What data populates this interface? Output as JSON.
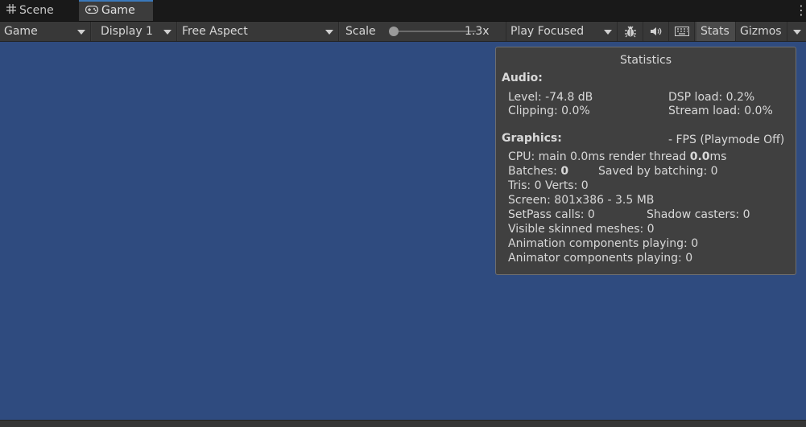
{
  "tabs": [
    {
      "label": "Scene",
      "icon": "grid-icon"
    },
    {
      "label": "Game",
      "icon": "gamepad-icon"
    }
  ],
  "toolbar": {
    "game_dropdown": "Game",
    "display_dropdown": "Display 1",
    "aspect_dropdown": "Free Aspect",
    "scale_label": "Scale",
    "scale_value": "1.3x",
    "scale_fraction": 0.05,
    "play_mode_dropdown": "Play Focused",
    "stats_button": "Stats",
    "gizmos_button": "Gizmos"
  },
  "colors": {
    "viewport_bg": "#2f4b7f",
    "tab_accent": "#3a79bb"
  },
  "statistics": {
    "title": "Statistics",
    "audio_header": "Audio:",
    "level": "Level: -74.8 dB",
    "dsp_load": "DSP load: 0.2%",
    "clipping": "Clipping: 0.0%",
    "stream_load": "Stream load: 0.0%",
    "graphics_header": "Graphics:",
    "fps": "- FPS (Playmode Off)",
    "cpu_prefix": "CPU: main 0.0ms  render thread ",
    "cpu_render": "0.0",
    "cpu_suffix": "ms",
    "batches_prefix": "Batches: ",
    "batches_value": "0",
    "saved_by_batching": "Saved by batching: 0",
    "tris_verts": "Tris: 0  Verts: 0",
    "screen": "Screen: 801x386 - 3.5 MB",
    "setpass": "SetPass calls: 0",
    "shadow_casters": "Shadow casters: 0",
    "skinned_meshes": "Visible skinned meshes: 0",
    "animation_components": "Animation components playing: 0",
    "animator_components": "Animator components playing: 0"
  }
}
